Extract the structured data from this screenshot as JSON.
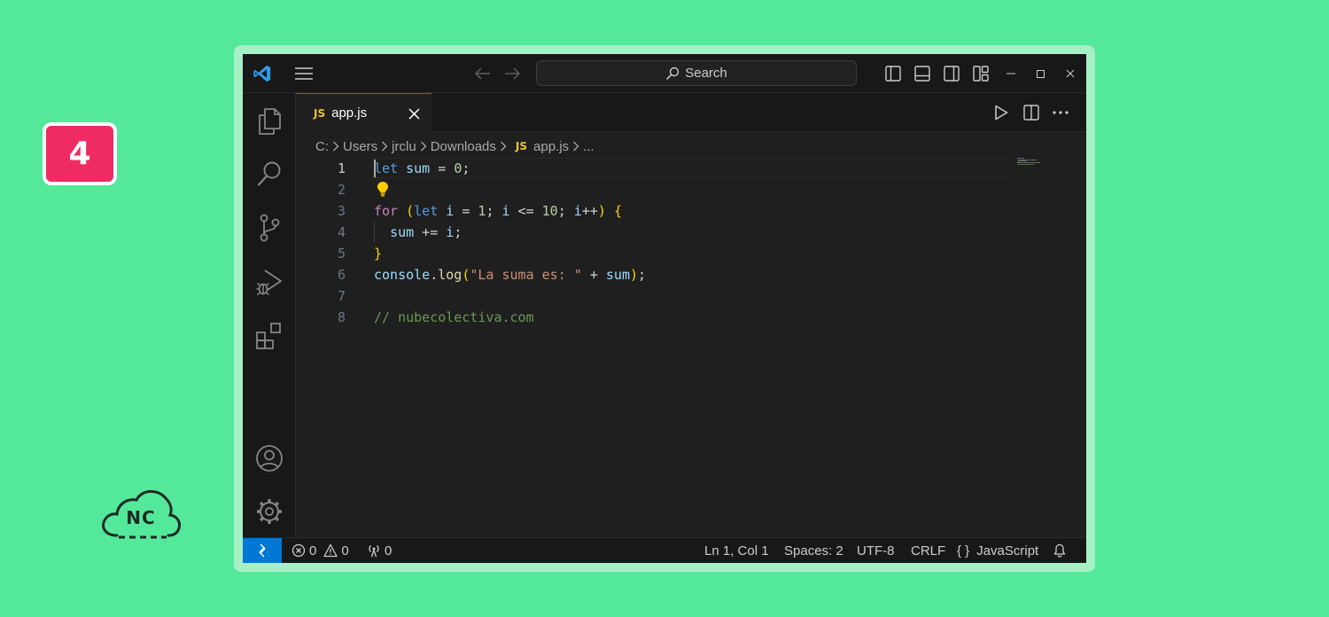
{
  "step_badge": "4",
  "logo": {
    "text": "NC"
  },
  "titlebar": {
    "search_label": "Search",
    "icons": [
      "vscode-logo-icon",
      "hamburger-menu-icon",
      "back-arrow-icon",
      "forward-arrow-icon",
      "toggle-primary-sidebar-icon",
      "toggle-panel-icon",
      "toggle-secondary-sidebar-icon",
      "customize-layout-icon",
      "minimize-icon",
      "maximize-icon",
      "close-window-icon"
    ]
  },
  "activity_bar": {
    "items": [
      "explorer-icon",
      "search-icon",
      "source-control-icon",
      "run-debug-icon",
      "extensions-icon"
    ],
    "bottom": [
      "accounts-icon",
      "manage-gear-icon"
    ]
  },
  "tab": {
    "badge": "JS",
    "label": "app.js"
  },
  "breadcrumb": {
    "items": [
      "C:",
      "Users",
      "jrclu",
      "Downloads"
    ],
    "file_badge": "JS",
    "file": "app.js",
    "more": "..."
  },
  "code": {
    "lines": [
      {
        "n": "1",
        "tokens": [
          [
            "kw",
            "let"
          ],
          [
            "op",
            " "
          ],
          [
            "var",
            "sum"
          ],
          [
            "op",
            " = "
          ],
          [
            "num",
            "0"
          ],
          [
            "op",
            ";"
          ]
        ]
      },
      {
        "n": "2",
        "tokens": []
      },
      {
        "n": "3",
        "tokens": [
          [
            "ctl",
            "for"
          ],
          [
            "op",
            " "
          ],
          [
            "br",
            "("
          ],
          [
            "kw",
            "let"
          ],
          [
            "op",
            " "
          ],
          [
            "var",
            "i"
          ],
          [
            "op",
            " = "
          ],
          [
            "num",
            "1"
          ],
          [
            "op",
            "; "
          ],
          [
            "var",
            "i"
          ],
          [
            "op",
            " <= "
          ],
          [
            "num",
            "10"
          ],
          [
            "op",
            "; "
          ],
          [
            "var",
            "i"
          ],
          [
            "op",
            "++"
          ],
          [
            "br",
            ")"
          ],
          [
            "op",
            " "
          ],
          [
            "br",
            "{"
          ]
        ]
      },
      {
        "n": "4",
        "tokens": [
          [
            "op",
            "  "
          ],
          [
            "var",
            "sum"
          ],
          [
            "op",
            " += "
          ],
          [
            "var",
            "i"
          ],
          [
            "op",
            ";"
          ]
        ]
      },
      {
        "n": "5",
        "tokens": [
          [
            "br",
            "}"
          ]
        ]
      },
      {
        "n": "6",
        "tokens": [
          [
            "var",
            "console"
          ],
          [
            "op",
            "."
          ],
          [
            "fn",
            "log"
          ],
          [
            "br",
            "("
          ],
          [
            "str",
            "\"La suma es: \""
          ],
          [
            "op",
            " + "
          ],
          [
            "var",
            "sum"
          ],
          [
            "br",
            ")"
          ],
          [
            "op",
            ";"
          ]
        ]
      },
      {
        "n": "7",
        "tokens": []
      },
      {
        "n": "8",
        "tokens": [
          [
            "cm",
            "// nubecolectiva.com"
          ]
        ]
      }
    ]
  },
  "statusbar": {
    "errors": "0",
    "warnings": "0",
    "ports": "0",
    "position": "Ln 1, Col 1",
    "spaces": "Spaces: 2",
    "encoding": "UTF-8",
    "eol": "CRLF",
    "language_icon": "{ }",
    "language": "JavaScript"
  },
  "colors": {
    "background": "#54e89b",
    "badge": "#ee2b62",
    "editor": "#1f1f1f",
    "chrome": "#181818",
    "accent": "#0078d4",
    "js_badge": "#e8c33b"
  }
}
